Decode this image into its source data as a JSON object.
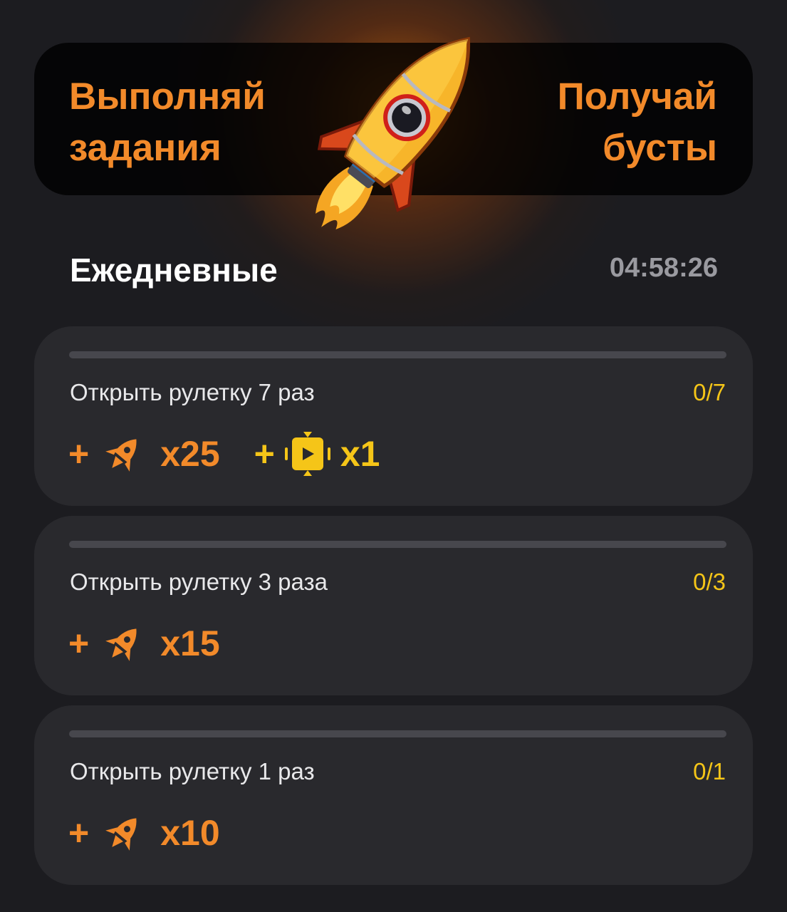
{
  "banner": {
    "left_line1": "Выполняй",
    "left_line2": "задания",
    "right_line1": "Получай",
    "right_line2": "бусты"
  },
  "section": {
    "title": "Ежедневные",
    "timer": "04:58:26"
  },
  "tasks": [
    {
      "title": "Открыть рулетку 7 раз",
      "progress_text": "0/7",
      "progress_fraction": 0,
      "rewards": [
        {
          "sign": "+",
          "icon": "rocket-icon",
          "amount": "x25",
          "color": "#f28a2a"
        },
        {
          "sign": "+",
          "icon": "ticket-icon",
          "amount": "x1",
          "color": "#f5c518"
        }
      ]
    },
    {
      "title": "Открыть рулетку 3 раза",
      "progress_text": "0/3",
      "progress_fraction": 0,
      "rewards": [
        {
          "sign": "+",
          "icon": "rocket-icon",
          "amount": "x15",
          "color": "#f28a2a"
        }
      ]
    },
    {
      "title": "Открыть рулетку 1 раз",
      "progress_text": "0/1",
      "progress_fraction": 0,
      "rewards": [
        {
          "sign": "+",
          "icon": "rocket-icon",
          "amount": "x10",
          "color": "#f28a2a"
        }
      ]
    }
  ],
  "colors": {
    "accent_orange": "#f28a2a",
    "accent_yellow": "#f5c518",
    "background": "#1c1c20",
    "card": "#29292d"
  }
}
